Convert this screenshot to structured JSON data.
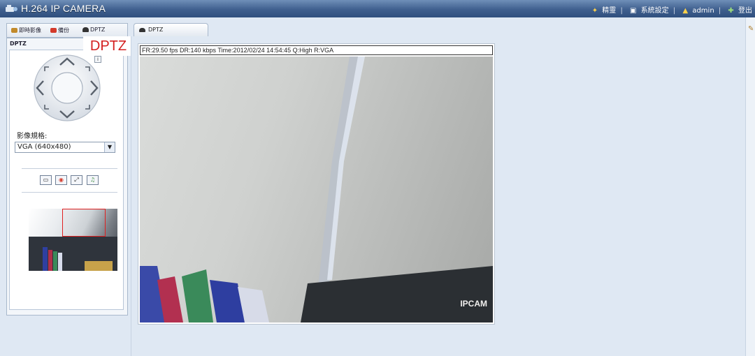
{
  "app": {
    "title": "H.264 IP CAMERA",
    "header_links": [
      {
        "label": "精靈",
        "icon": "wizard-icon"
      },
      {
        "label": "系統設定",
        "icon": "system-settings-icon"
      },
      {
        "label": "admin",
        "icon": "user-icon"
      },
      {
        "label": "登出",
        "icon": "logout-icon"
      }
    ]
  },
  "left_tabs": [
    {
      "label": "即時影像",
      "icon": "live-view-icon"
    },
    {
      "label": "備份",
      "icon": "backup-icon"
    },
    {
      "label": "DPTZ",
      "icon": "dptz-icon"
    }
  ],
  "panel": {
    "header": "DPTZ",
    "callout": "DPTZ",
    "info_icon": "i",
    "quality_label": "影像規格:",
    "quality_value": "VGA (640x480)",
    "tools": [
      {
        "icon": "snapshot-icon",
        "glyph": "▭"
      },
      {
        "icon": "record-icon",
        "glyph": "◉"
      },
      {
        "icon": "fullscreen-icon",
        "glyph": "⤢"
      },
      {
        "icon": "audio-icon",
        "glyph": "♫"
      }
    ]
  },
  "center_tab": {
    "label": "DPTZ"
  },
  "video": {
    "info": "FR:29.50 fps  DR:140 kbps Time:2012/02/24 14:54:45 Q:High R:VGA",
    "watermark": "IPCAM"
  },
  "colors": {
    "header_bar": "#3f5f8e",
    "callout_text": "#d42020",
    "roi_box": "#e02020"
  }
}
